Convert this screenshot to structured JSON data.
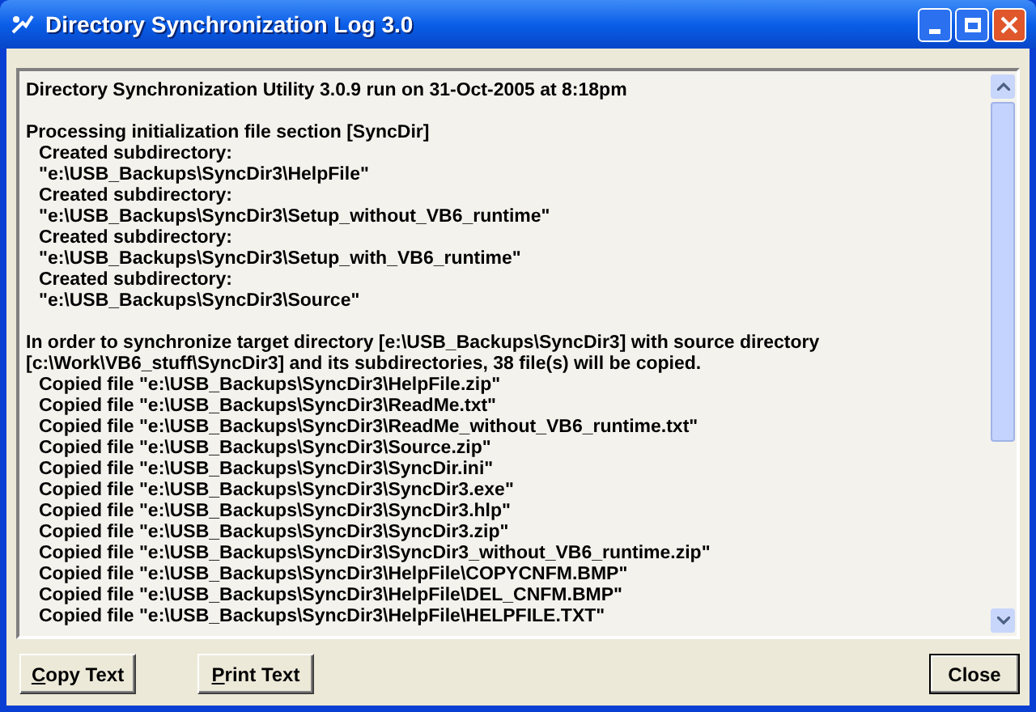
{
  "window": {
    "title": "Directory Synchronization Log 3.0"
  },
  "log": [
    {
      "lines": [
        {
          "kind": "plain",
          "text": "Directory Synchronization Utility 3.0.9 run on 31-Oct-2005 at 8:18pm"
        }
      ]
    },
    {
      "lines": [
        {
          "kind": "plain",
          "text": "Processing initialization file section [SyncDir]"
        },
        {
          "kind": "indented",
          "text": "Created subdirectory:"
        },
        {
          "kind": "indented",
          "text": "\"e:\\USB_Backups\\SyncDir3\\HelpFile\""
        },
        {
          "kind": "indented",
          "text": "Created subdirectory:"
        },
        {
          "kind": "indented",
          "text": "\"e:\\USB_Backups\\SyncDir3\\Setup_without_VB6_runtime\""
        },
        {
          "kind": "indented",
          "text": "Created subdirectory:"
        },
        {
          "kind": "indented",
          "text": "\"e:\\USB_Backups\\SyncDir3\\Setup_with_VB6_runtime\""
        },
        {
          "kind": "indented",
          "text": "Created subdirectory:"
        },
        {
          "kind": "indented",
          "text": "\"e:\\USB_Backups\\SyncDir3\\Source\""
        }
      ]
    },
    {
      "lines": [
        {
          "kind": "plain",
          "text": "In order to synchronize target directory [e:\\USB_Backups\\SyncDir3] with source directory"
        },
        {
          "kind": "plain",
          "text": "[c:\\Work\\VB6_stuff\\SyncDir3] and its subdirectories, 38 file(s) will be copied."
        },
        {
          "kind": "indented",
          "text": "Copied file \"e:\\USB_Backups\\SyncDir3\\HelpFile.zip\""
        },
        {
          "kind": "indented",
          "text": "Copied file \"e:\\USB_Backups\\SyncDir3\\ReadMe.txt\""
        },
        {
          "kind": "indented",
          "text": "Copied file \"e:\\USB_Backups\\SyncDir3\\ReadMe_without_VB6_runtime.txt\""
        },
        {
          "kind": "indented",
          "text": "Copied file \"e:\\USB_Backups\\SyncDir3\\Source.zip\""
        },
        {
          "kind": "indented",
          "text": "Copied file \"e:\\USB_Backups\\SyncDir3\\SyncDir.ini\""
        },
        {
          "kind": "indented",
          "text": "Copied file \"e:\\USB_Backups\\SyncDir3\\SyncDir3.exe\""
        },
        {
          "kind": "indented",
          "text": "Copied file \"e:\\USB_Backups\\SyncDir3\\SyncDir3.hlp\""
        },
        {
          "kind": "indented",
          "text": "Copied file \"e:\\USB_Backups\\SyncDir3\\SyncDir3.zip\""
        },
        {
          "kind": "indented",
          "text": "Copied file \"e:\\USB_Backups\\SyncDir3\\SyncDir3_without_VB6_runtime.zip\""
        },
        {
          "kind": "indented",
          "text": "Copied file \"e:\\USB_Backups\\SyncDir3\\HelpFile\\COPYCNFM.BMP\""
        },
        {
          "kind": "indented",
          "text": "Copied file \"e:\\USB_Backups\\SyncDir3\\HelpFile\\DEL_CNFM.BMP\""
        },
        {
          "kind": "indented",
          "text": "Copied file \"e:\\USB_Backups\\SyncDir3\\HelpFile\\HELPFILE.TXT\""
        }
      ]
    }
  ],
  "buttons": [
    {
      "kind": "left",
      "mnemonic": "C",
      "rest": "opy Text"
    },
    {
      "kind": "left",
      "mnemonic": "P",
      "rest": "rint Text"
    },
    {
      "kind": "right",
      "rest": "Close"
    }
  ]
}
